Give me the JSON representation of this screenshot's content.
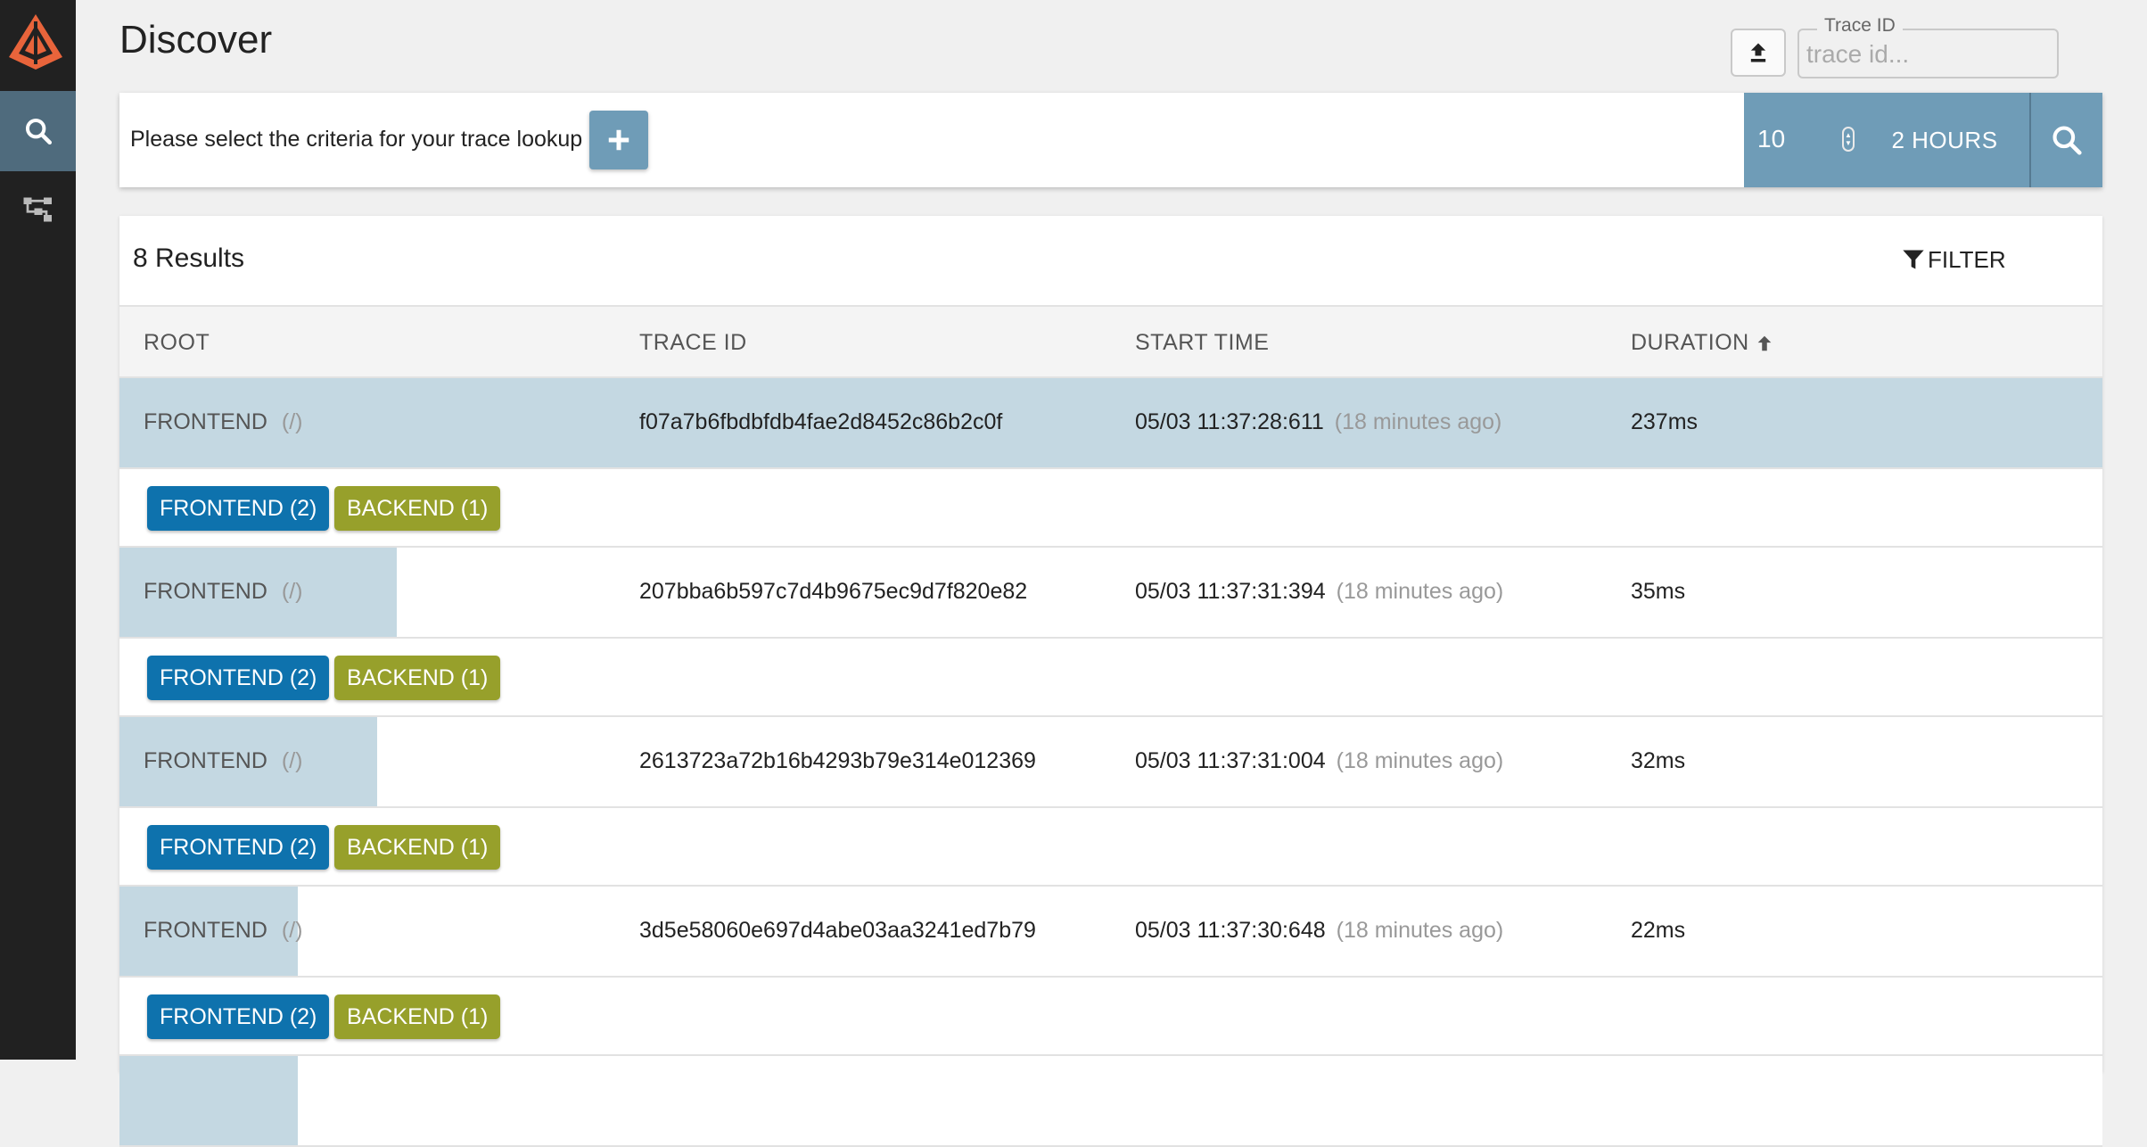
{
  "header": {
    "title": "Discover",
    "trace_id_label": "Trace ID",
    "trace_id_placeholder": "trace id..."
  },
  "search": {
    "criteria_prompt": "Please select the criteria for your trace lookup",
    "limit": "10",
    "lookback": "2 HOURS"
  },
  "results": {
    "count_label": "8 Results",
    "filter_label": "FILTER",
    "columns": [
      "ROOT",
      "TRACE ID",
      "START TIME",
      "DURATION"
    ],
    "rows": [
      {
        "root": "FRONTEND",
        "path": "(/)",
        "trace_id": "f07a7b6fbdbfdb4fae2d8452c86b2c0f",
        "start": "05/03 11:37:28:611",
        "ago": "(18 minutes ago)",
        "duration": "237ms",
        "duration_fraction": 1.0,
        "tags": [
          "FRONTEND (2)",
          "BACKEND (1)"
        ]
      },
      {
        "root": "FRONTEND",
        "path": "(/)",
        "trace_id": "207bba6b597c7d4b9675ec9d7f820e82",
        "start": "05/03 11:37:31:394",
        "ago": "(18 minutes ago)",
        "duration": "35ms",
        "duration_fraction": 0.14,
        "tags": [
          "FRONTEND (2)",
          "BACKEND (1)"
        ]
      },
      {
        "root": "FRONTEND",
        "path": "(/)",
        "trace_id": "2613723a72b16b4293b79e314e012369",
        "start": "05/03 11:37:31:004",
        "ago": "(18 minutes ago)",
        "duration": "32ms",
        "duration_fraction": 0.13,
        "tags": [
          "FRONTEND (2)",
          "BACKEND (1)"
        ]
      },
      {
        "root": "FRONTEND",
        "path": "(/)",
        "trace_id": "3d5e58060e697d4abe03aa3241ed7b79",
        "start": "05/03 11:37:30:648",
        "ago": "(18 minutes ago)",
        "duration": "22ms",
        "duration_fraction": 0.09,
        "tags": [
          "FRONTEND (2)",
          "BACKEND (1)"
        ]
      }
    ]
  },
  "colors": {
    "sidebar": "#212121",
    "sidebar_active": "#4f6b7d",
    "accent": "#6f9cb7",
    "row_bar": "#c4d8e2",
    "frontend_tag": "#0e72ad",
    "backend_tag": "#97a02b",
    "logo": "#e8643b"
  },
  "icons": {
    "logo": "zipkin-logo-icon",
    "search": "search-icon",
    "dependencies": "dependencies-icon",
    "upload": "upload-icon",
    "add": "plus-icon",
    "filter": "filter-icon",
    "sort": "arrow-up-icon"
  }
}
